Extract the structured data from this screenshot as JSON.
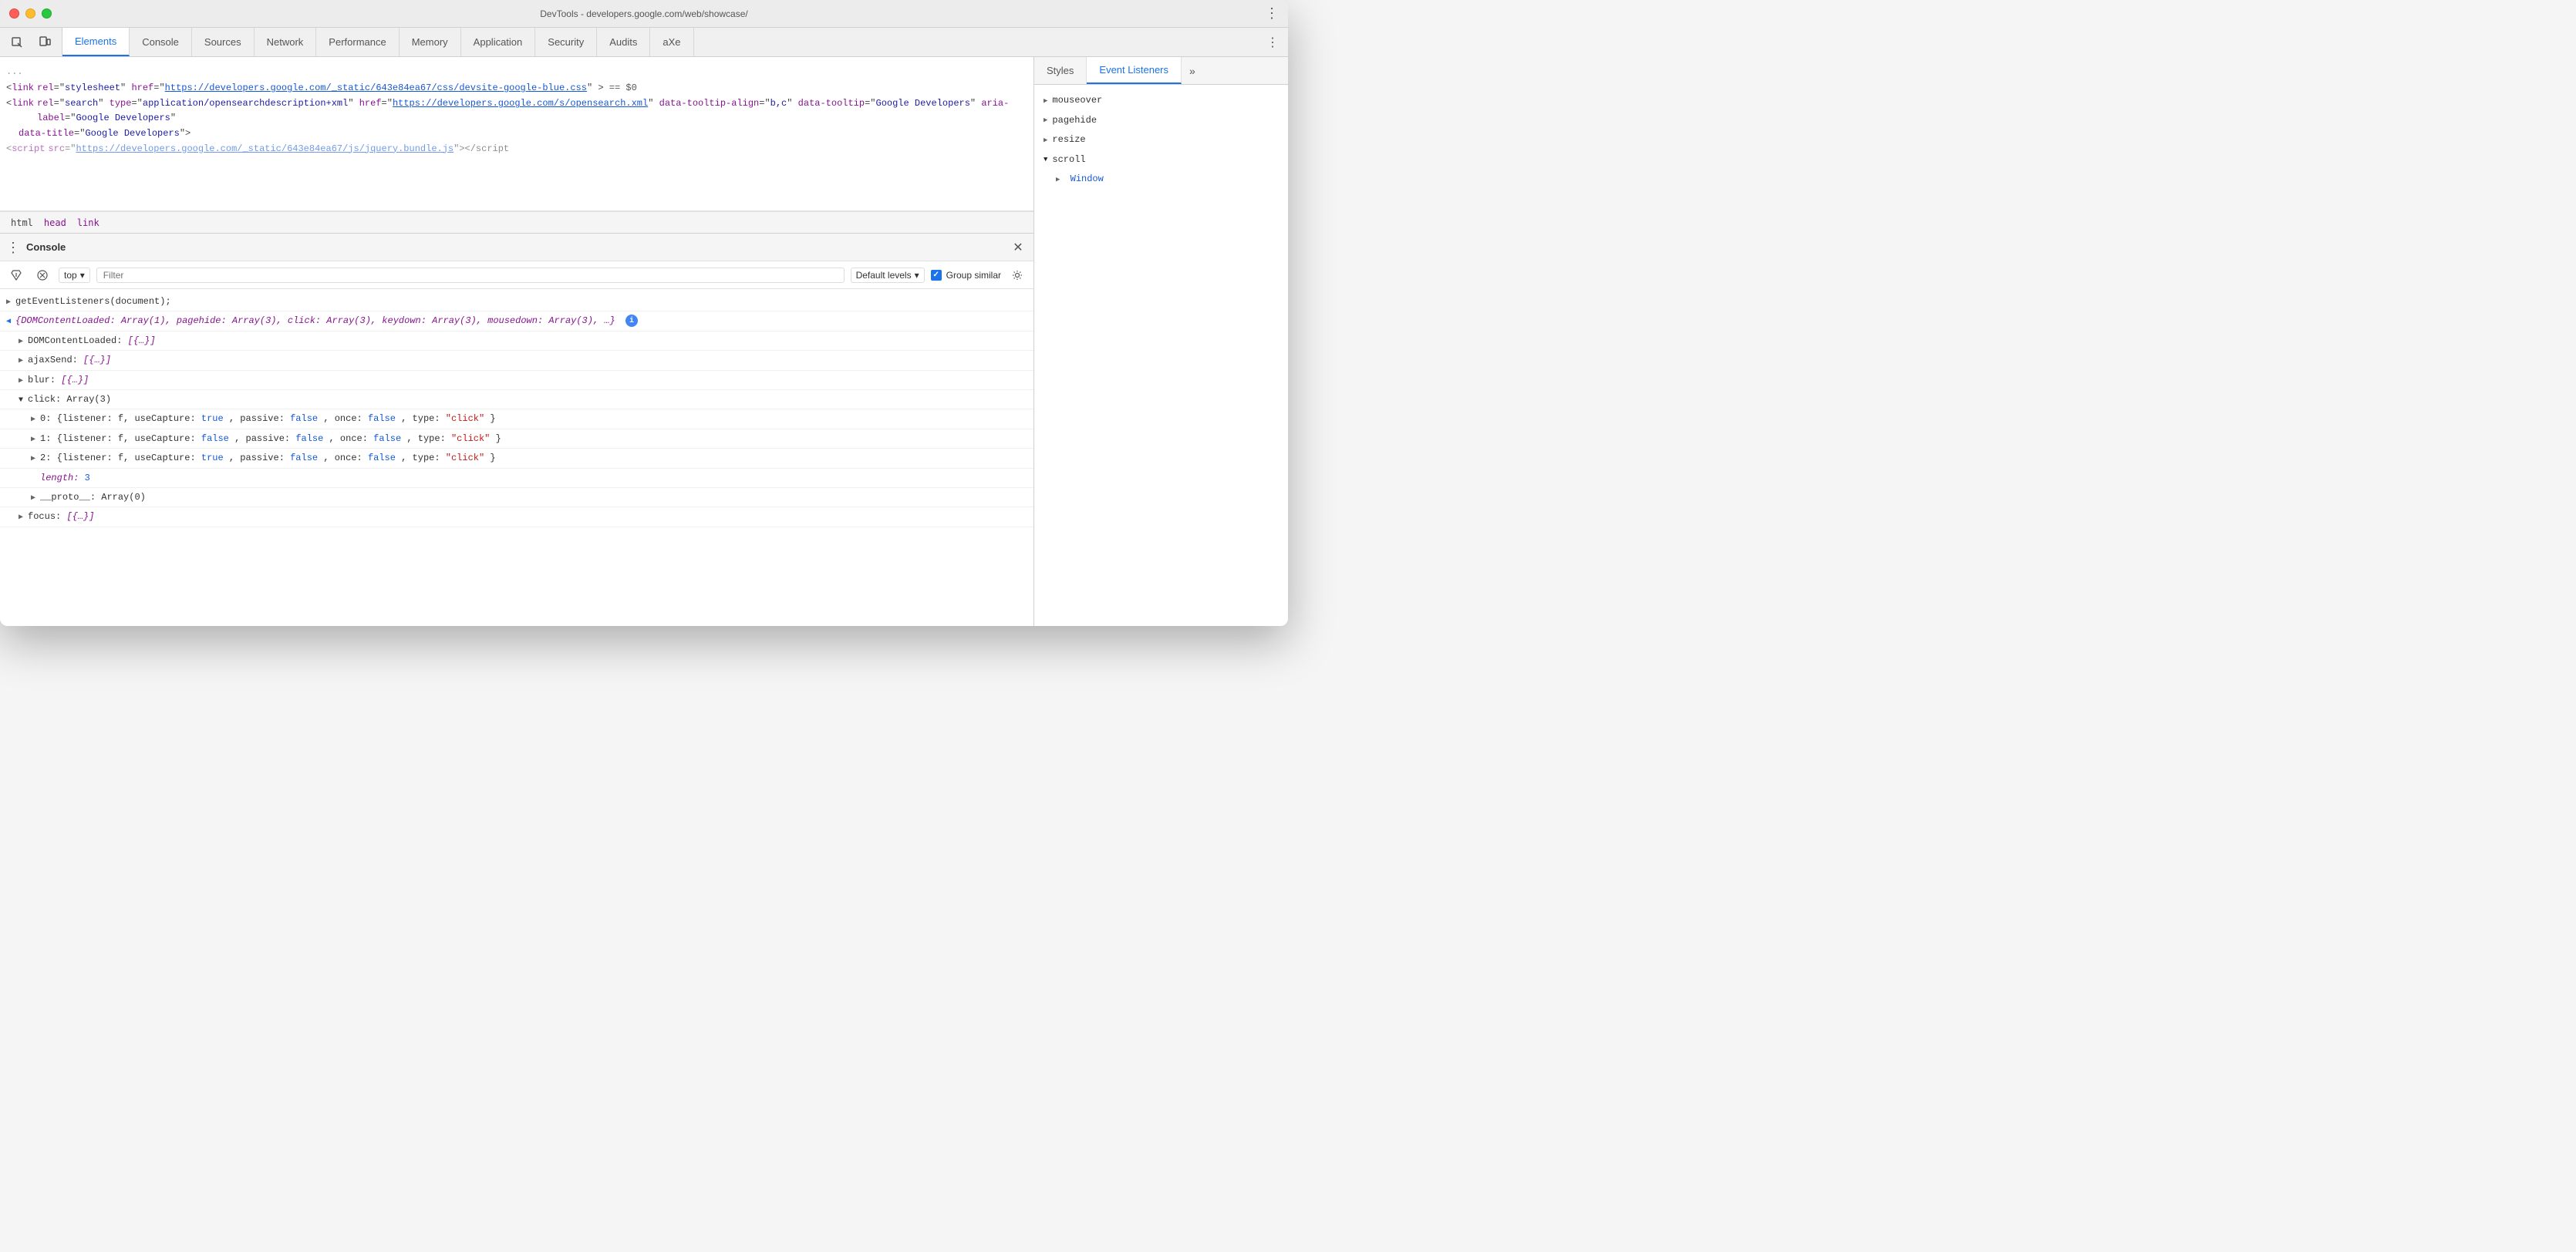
{
  "window": {
    "title": "DevTools - developers.google.com/web/showcase/"
  },
  "tabs": {
    "items": [
      {
        "id": "elements",
        "label": "Elements",
        "active": true
      },
      {
        "id": "console",
        "label": "Console",
        "active": false
      },
      {
        "id": "sources",
        "label": "Sources",
        "active": false
      },
      {
        "id": "network",
        "label": "Network",
        "active": false
      },
      {
        "id": "performance",
        "label": "Performance",
        "active": false
      },
      {
        "id": "memory",
        "label": "Memory",
        "active": false
      },
      {
        "id": "application",
        "label": "Application",
        "active": false
      },
      {
        "id": "security",
        "label": "Security",
        "active": false
      },
      {
        "id": "audits",
        "label": "Audits",
        "active": false
      },
      {
        "id": "axe",
        "label": "aXe",
        "active": false
      }
    ]
  },
  "elements_panel": {
    "code_lines": [
      {
        "id": "line1",
        "indent": 0,
        "content": "<link rel=\"stylesheet\" href=\"https://developers.google.com/_static/643e84ea67/css/devsite-google-blue.css\"> == $0"
      },
      {
        "id": "line2",
        "indent": 0,
        "content": "<link rel=\"search\" type=\"application/opensearchdescription+xml\" href=\"https://developers.google.com/s/opensearch.xml\" data-tooltip-align=\"b,c\" data-tooltip=\"Google Developers\" aria-label=\"Google Developers\" data-title=\"Google Developers\">"
      },
      {
        "id": "line3",
        "indent": 0,
        "content": "<script src=\"https://developers.google.com/_static/643e84ea67/js/jquery.bundle.js\"></script"
      }
    ],
    "breadcrumb": [
      "html",
      "head",
      "link"
    ]
  },
  "right_panel": {
    "tabs": [
      "Styles",
      "Event Listeners"
    ],
    "active_tab": "Event Listeners",
    "events": [
      {
        "name": "mouseover",
        "expanded": false
      },
      {
        "name": "pagehide",
        "expanded": false
      },
      {
        "name": "resize",
        "expanded": false
      },
      {
        "name": "scroll",
        "expanded": true,
        "children": [
          "Window"
        ]
      }
    ]
  },
  "console": {
    "title": "Console",
    "context": "top",
    "filter_placeholder": "Filter",
    "levels_label": "Default levels",
    "group_similar_label": "Group similar",
    "group_similar_checked": true,
    "entries": [
      {
        "id": "cmd1",
        "type": "input",
        "arrow": "▶",
        "content": "getEventListeners(document);"
      },
      {
        "id": "obj1",
        "type": "output",
        "arrow": "◀",
        "content_raw": "{DOMContentLoaded: Array(1), pagehide: Array(3), click: Array(3), keydown: Array(3), mousedown: Array(3), …}",
        "has_info": true,
        "expanded": true,
        "children": [
          {
            "id": "c1",
            "arrow": "▶",
            "label": "DOMContentLoaded:",
            "value": "[{…}]"
          },
          {
            "id": "c2",
            "arrow": "▶",
            "label": "ajaxSend:",
            "value": "[{…}]"
          },
          {
            "id": "c3",
            "arrow": "▶",
            "label": "blur:",
            "value": "[{…}]"
          },
          {
            "id": "c4",
            "arrow": "▼",
            "label": "click:",
            "value": "Array(3)",
            "expanded": true,
            "children": [
              {
                "id": "c4a",
                "label": "▶ 0:",
                "value": "{listener: f, useCapture: true, passive: false, once: false, type: \"click\"}"
              },
              {
                "id": "c4b",
                "label": "▶ 1:",
                "value": "{listener: f, useCapture: false, passive: false, once: false, type: \"click\"}"
              },
              {
                "id": "c4c",
                "label": "▶ 2:",
                "value": "{listener: f, useCapture: true, passive: false, once: false, type: \"click\"}"
              },
              {
                "id": "c4d",
                "label": "length:",
                "value": "3",
                "is_length": true
              },
              {
                "id": "c4e",
                "label": "▶ __proto__:",
                "value": "Array(0)"
              }
            ]
          },
          {
            "id": "c5",
            "arrow": "▶",
            "label": "focus:",
            "value": "[{…}]"
          }
        ]
      }
    ]
  }
}
